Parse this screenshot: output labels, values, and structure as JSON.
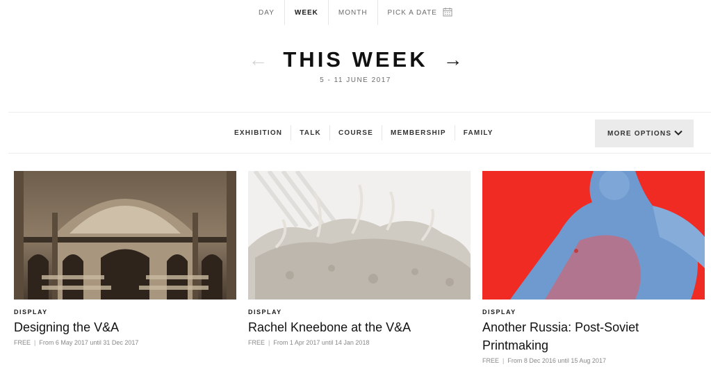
{
  "period_tabs": [
    {
      "label": "DAY",
      "active": false
    },
    {
      "label": "WEEK",
      "active": true
    },
    {
      "label": "MONTH",
      "active": false
    },
    {
      "label": "PICK A DATE",
      "active": false
    }
  ],
  "heading": {
    "title": "THIS WEEK",
    "date_range": "5 - 11 JUNE 2017",
    "prev_arrow": "←",
    "next_arrow": "→"
  },
  "filters": [
    "EXHIBITION",
    "TALK",
    "COURSE",
    "MEMBERSHIP",
    "FAMILY"
  ],
  "more_options": {
    "label": "MORE OPTIONS"
  },
  "cards": [
    {
      "category": "DISPLAY",
      "title": "Designing the V&A",
      "price": "FREE",
      "dates": "From 6 May 2017 until 31 Dec 2017"
    },
    {
      "category": "DISPLAY",
      "title": "Rachel Kneebone at the V&A",
      "price": "FREE",
      "dates": "From 1 Apr 2017 until 14 Jan 2018"
    },
    {
      "category": "DISPLAY",
      "title": "Another Russia: Post-Soviet Printmaking",
      "price": "FREE",
      "dates": "From 8 Dec 2016 until 15 Aug 2017"
    }
  ],
  "colors": {
    "accent_red": "#ef2b24",
    "accent_blue": "#6f9ad0",
    "sepia": "#5a4a3a",
    "porcelain": "#e9e6e0"
  }
}
